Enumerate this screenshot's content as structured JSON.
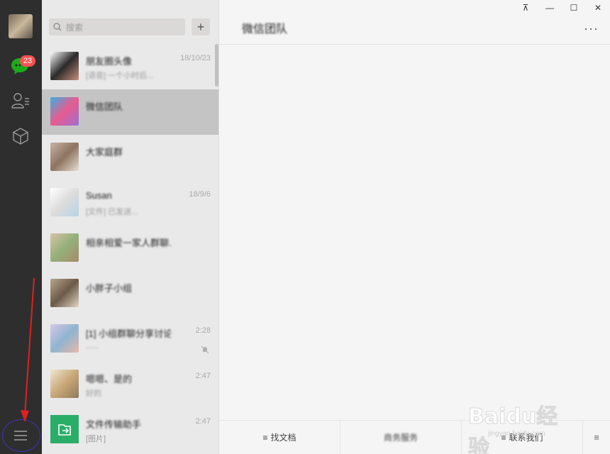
{
  "nav": {
    "badge_count": "23",
    "icons": [
      "chat-icon",
      "contacts-icon",
      "favorites-icon",
      "menu-icon"
    ]
  },
  "chat_list": {
    "search_placeholder": "搜索",
    "add_label": "+",
    "items": [
      {
        "name": "朋友圈头像",
        "preview": "[语音] 一个小时后...",
        "time": "18/10/23",
        "avatar_colors": [
          "#ffffff",
          "#2a2a2a",
          "#c88d7a"
        ]
      },
      {
        "name": "微信团队",
        "preview": "",
        "time": "",
        "avatar_colors": [
          "#3ab0e0",
          "#e85b8f",
          "#9c6fd6"
        ]
      },
      {
        "name": "大家庭群",
        "preview": "",
        "time": "",
        "avatar_colors": [
          "#c7b3a4",
          "#8d7461",
          "#e9ddd1"
        ]
      },
      {
        "name": "Susan",
        "preview": "[文件] 已发送...",
        "time": "18/9/6",
        "avatar_colors": [
          "#ffffff",
          "#dcdcdc",
          "#b6d4e8"
        ]
      },
      {
        "name": "相亲相爱一家人群聊...",
        "preview": "",
        "time": "",
        "avatar_colors": [
          "#d8c3a5",
          "#94b07a",
          "#a78a6a"
        ]
      },
      {
        "name": "小胖子小组",
        "preview": "",
        "time": "",
        "avatar_colors": [
          "#b9a58c",
          "#6b5a48",
          "#e3d6c3"
        ]
      },
      {
        "name": "[1] 小组群聊分享讨论会...",
        "preview": "......",
        "time": "2:28",
        "avatar_colors": [
          "#d6c7e8",
          "#8fb4cf",
          "#e8b8a8"
        ]
      },
      {
        "name": "嗯嗯、是的",
        "preview": "好的",
        "time": "2:47",
        "avatar_colors": [
          "#efe6d2",
          "#c9a877",
          "#8f7a5c"
        ]
      },
      {
        "name": "文件传输助手",
        "preview": "[图片]",
        "time": "2:47",
        "avatar_colors": [
          "#2aae67",
          "#2aae67",
          "#2aae67"
        ]
      }
    ]
  },
  "main": {
    "title": "微信团队",
    "more_label": "···",
    "window_controls": [
      "⊼",
      "—",
      "☐",
      "✕"
    ],
    "bottom_bar": [
      {
        "label": "找文档",
        "icon": "≡",
        "blurred": false
      },
      {
        "label": "商务服务",
        "icon": "",
        "blurred": true
      },
      {
        "label": "联系我们",
        "icon": "≡",
        "blurred": false
      }
    ],
    "side_toggle": "≡"
  },
  "watermark": {
    "text": "Baidu经验",
    "sub": "jingyan.baidu.com"
  },
  "colors": {
    "nav_bg": "#2e2e2e",
    "list_bg": "#e9e9e9",
    "selected_bg": "#c5c4c4",
    "main_bg": "#f5f5f5",
    "badge": "#fa5151",
    "chat_icon": "#1aad19",
    "annotation_arrow": "#e02020",
    "annotation_ring": "#3b34b9"
  }
}
